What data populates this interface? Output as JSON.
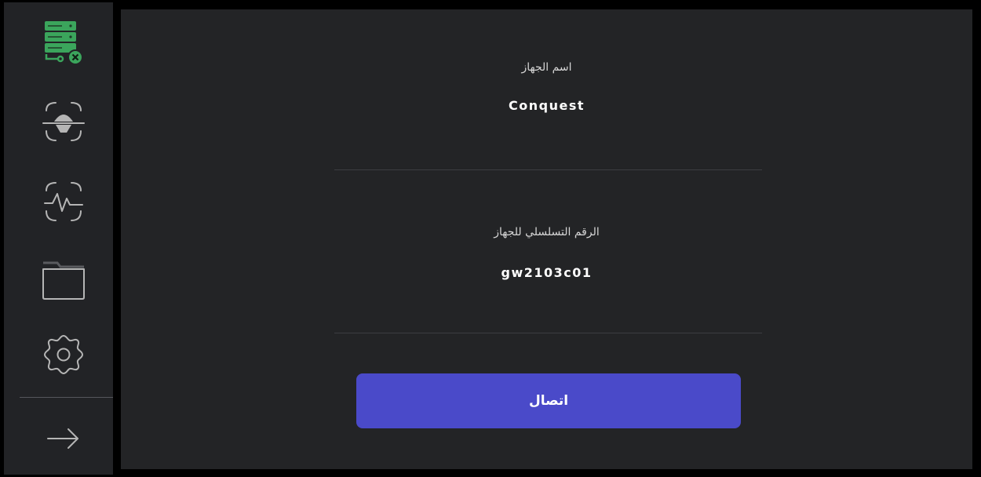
{
  "sidebar": {
    "items": [
      {
        "icon": "server-disconnected-icon",
        "active": true,
        "color": "#3ba55c"
      },
      {
        "icon": "scan-icon",
        "active": false
      },
      {
        "icon": "heart-rate-icon",
        "active": false
      },
      {
        "icon": "folder-icon",
        "active": false
      },
      {
        "icon": "settings-icon",
        "active": false
      },
      {
        "icon": "arrow-right-icon",
        "active": false
      }
    ],
    "inactive_color": "#b5b5b5"
  },
  "device": {
    "name_label": "اسم الجهاز",
    "name_value": "Conquest",
    "serial_label": "الرقم التسلسلي للجهاز",
    "serial_value": "gw2103c01"
  },
  "actions": {
    "connect_label": "اتصال"
  },
  "colors": {
    "accent": "#4a4ac9",
    "success": "#3ba55c",
    "error": "#3ba55c",
    "panel": "#232426",
    "sidebar": "#222326"
  }
}
